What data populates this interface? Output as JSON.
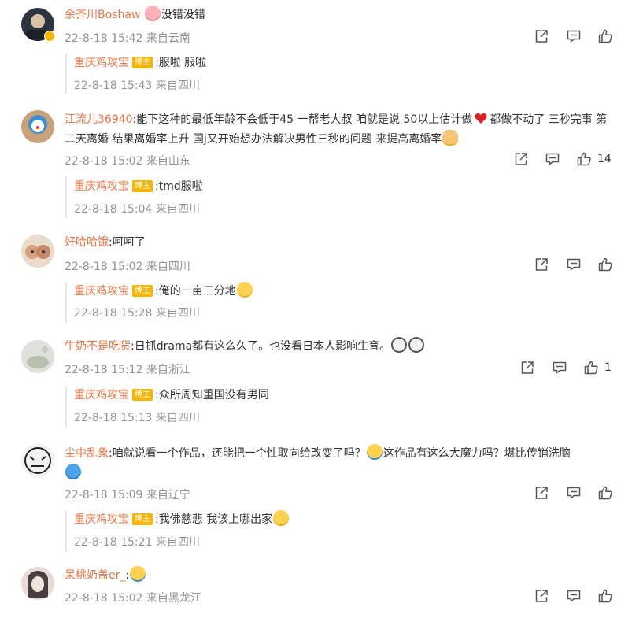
{
  "comments": [
    {
      "user": "余芥川Boshaw",
      "content": "没错没错",
      "emojis_before": [
        "cute-face"
      ],
      "time": "22-8-18 15:42 来自云南",
      "likes": "",
      "verified": true,
      "reply": {
        "user": "重庆鸡攻宝",
        "badge": "博主",
        "content": "服啦 服啦",
        "time": "22-8-18 15:43 来自四川"
      }
    },
    {
      "user": "江流儿36940",
      "content_a": "能下这种的最低年龄不会低于45 一帮老大叔 咱就是说 50以上估计做",
      "content_b": "都做不动了 三秒完事 第二天离婚 结果离婚率上升 国j又开始想办法解决男性三秒的问题 来提高离婚率",
      "time": "22-8-18 15:02 来自山东",
      "likes": "14",
      "reply": {
        "user": "重庆鸡攻宝",
        "badge": "博主",
        "content": "tmd服啦",
        "time": "22-8-18 15:04 来自四川"
      }
    },
    {
      "user": "好哈哈饿",
      "content": "呵呵了",
      "time": "22-8-18 15:02 来自四川",
      "likes": "",
      "reply": {
        "user": "重庆鸡攻宝",
        "badge": "博主",
        "content": "俺的一亩三分地",
        "time": "22-8-18 15:28 来自四川"
      }
    },
    {
      "user": "牛奶不是吃货",
      "content": "日抓drama都有这么久了。也没看日本人影响生育。",
      "time": "22-8-18 15:12 来自浙江",
      "likes": "1",
      "reply": {
        "user": "重庆鸡攻宝",
        "badge": "博主",
        "content": "众所周知重国没有男同",
        "time": "22-8-18 15:13 来自四川"
      }
    },
    {
      "user": "尘中乱象",
      "content_a": "咱就说看一个作品，还能把一个性取向给改变了吗？",
      "content_b": "这作品有这么大魔力吗？堪比传销洗脑",
      "time": "22-8-18 15:09 来自辽宁",
      "likes": "",
      "reply": {
        "user": "重庆鸡攻宝",
        "badge": "博主",
        "content": "我佛慈悲 我该上哪出家",
        "time": "22-8-18 15:21 来自四川"
      }
    },
    {
      "user": "呆桃奶盖er_",
      "content": "",
      "time": "22-8-18 15:02 来自黑龙江",
      "likes": ""
    }
  ],
  "icons": {
    "share": "share-icon",
    "comment": "comment-icon",
    "like": "like-icon"
  },
  "colors": {
    "username": "#eb7340",
    "meta": "#939393",
    "badge": "#f7b500"
  }
}
